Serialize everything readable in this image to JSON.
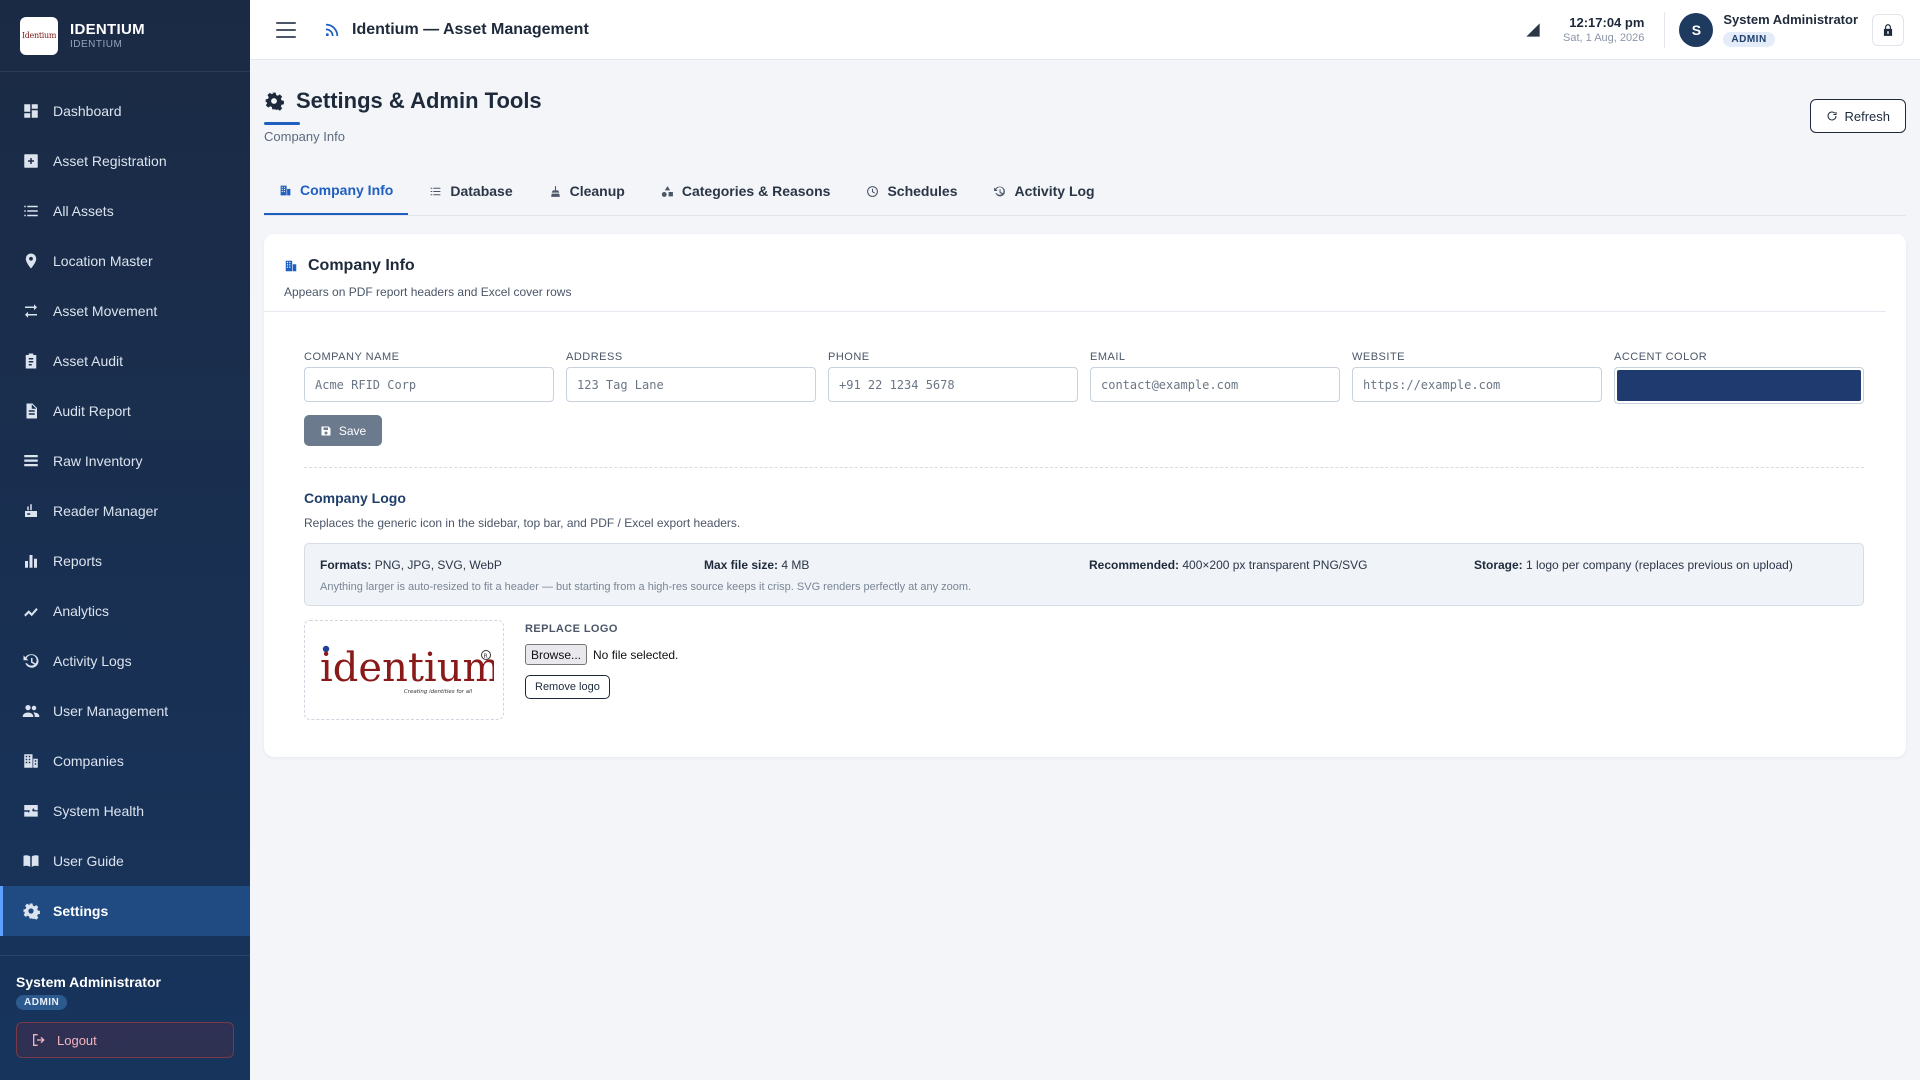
{
  "brand": {
    "name": "IDENTIUM",
    "sub": "IDENTIUM",
    "logo_text": "Identium"
  },
  "sidebar": {
    "items": [
      {
        "label": "Dashboard",
        "icon": "dashboard-icon"
      },
      {
        "label": "Asset Registration",
        "icon": "plus-square-icon"
      },
      {
        "label": "All Assets",
        "icon": "list-icon"
      },
      {
        "label": "Location Master",
        "icon": "map-pin-icon"
      },
      {
        "label": "Asset Movement",
        "icon": "swap-arrows-icon"
      },
      {
        "label": "Asset Audit",
        "icon": "clipboard-icon"
      },
      {
        "label": "Audit Report",
        "icon": "file-icon"
      },
      {
        "label": "Raw Inventory",
        "icon": "stack-icon"
      },
      {
        "label": "Reader Manager",
        "icon": "reader-icon"
      },
      {
        "label": "Reports",
        "icon": "bar-chart-icon"
      },
      {
        "label": "Analytics",
        "icon": "trend-icon"
      },
      {
        "label": "Activity Logs",
        "icon": "history-icon"
      },
      {
        "label": "User Management",
        "icon": "users-icon"
      },
      {
        "label": "Companies",
        "icon": "building-icon"
      },
      {
        "label": "System Health",
        "icon": "pulse-icon"
      },
      {
        "label": "User Guide",
        "icon": "book-icon"
      },
      {
        "label": "Settings",
        "icon": "gear-icon",
        "active": true
      }
    ],
    "user": {
      "name": "System Administrator",
      "role": "ADMIN"
    },
    "logout_label": "Logout"
  },
  "topbar": {
    "title": "Identium — Asset Management",
    "time": "12:17:04 pm",
    "date": "Sat, 1 Aug, 2026",
    "avatar_initial": "S",
    "user_name": "System Administrator",
    "user_role": "ADMIN"
  },
  "page": {
    "title": "Settings & Admin Tools",
    "subtitle": "Company Info",
    "refresh_label": "Refresh"
  },
  "tabs": [
    {
      "label": "Company Info",
      "icon": "building-icon",
      "active": true
    },
    {
      "label": "Database",
      "icon": "list-icon"
    },
    {
      "label": "Cleanup",
      "icon": "broom-icon"
    },
    {
      "label": "Categories & Reasons",
      "icon": "shapes-icon"
    },
    {
      "label": "Schedules",
      "icon": "clock-icon"
    },
    {
      "label": "Activity Log",
      "icon": "history-icon"
    }
  ],
  "company_info": {
    "title": "Company Info",
    "subtitle": "Appears on PDF report headers and Excel cover rows",
    "fields": {
      "company_name": {
        "label": "COMPANY NAME",
        "placeholder": "Acme RFID Corp"
      },
      "address": {
        "label": "ADDRESS",
        "placeholder": "123 Tag Lane"
      },
      "phone": {
        "label": "PHONE",
        "placeholder": "+91 22 1234 5678"
      },
      "email": {
        "label": "EMAIL",
        "placeholder": "contact@example.com"
      },
      "website": {
        "label": "WEBSITE",
        "placeholder": "https://example.com"
      },
      "accent_color": {
        "label": "ACCENT COLOR",
        "value": "#1e3a6e"
      }
    },
    "save_label": "Save"
  },
  "company_logo": {
    "title": "Company Logo",
    "subtitle": "Replaces the generic icon in the sidebar, top bar, and PDF / Excel export headers.",
    "formats_label": "Formats:",
    "formats_value": "PNG, JPG, SVG, WebP",
    "max_label": "Max file size:",
    "max_value": "4 MB",
    "recommended_label": "Recommended:",
    "recommended_value": "400×200 px transparent PNG/SVG",
    "storage_label": "Storage:",
    "storage_value": "1 logo per company (replaces previous on upload)",
    "note": "Anything larger is auto-resized to fit a header — but starting from a high-res source keeps it crisp. SVG renders perfectly at any zoom.",
    "logo_wordmark": "identium",
    "logo_tagline": "Creating identities for all",
    "replace_label": "REPLACE LOGO",
    "browse_label": "Browse...",
    "file_status": "No file selected.",
    "remove_label": "Remove logo"
  },
  "colors": {
    "accent": "#1f5fbf",
    "sidebar": "#1b2a44",
    "swatch": "#1e3a6e"
  }
}
